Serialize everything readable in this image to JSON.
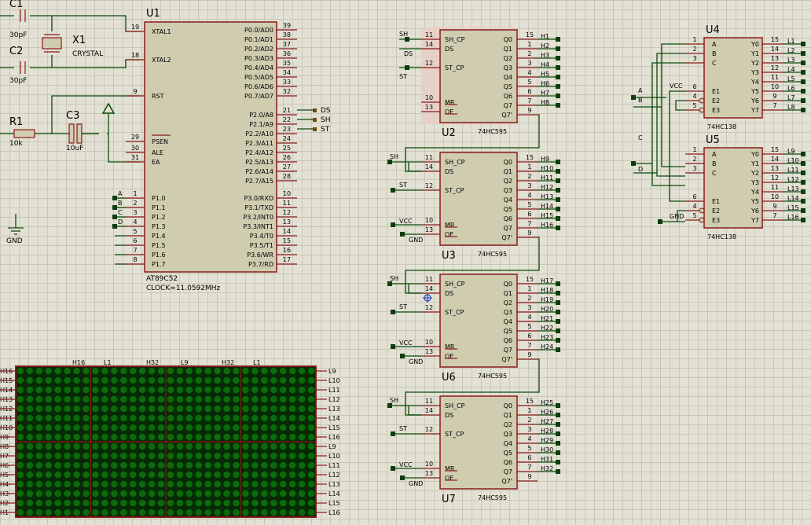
{
  "u1": {
    "ref": "U1",
    "part": "AT89C52",
    "clock": "CLOCK=11.0592MHz",
    "left_pins": [
      {
        "num": "19",
        "name": "XTAL1"
      },
      {
        "num": "18",
        "name": "XTAL2"
      },
      {
        "num": "9",
        "name": "RST"
      },
      {
        "num": "29",
        "name": "PSEN"
      },
      {
        "num": "30",
        "name": "ALE"
      },
      {
        "num": "31",
        "name": "EA"
      },
      {
        "num": "1",
        "name": "P1.0"
      },
      {
        "num": "2",
        "name": "P1.1"
      },
      {
        "num": "3",
        "name": "P1.2"
      },
      {
        "num": "4",
        "name": "P1.3"
      },
      {
        "num": "5",
        "name": "P1.4"
      },
      {
        "num": "6",
        "name": "P1.5"
      },
      {
        "num": "7",
        "name": "P1.6"
      },
      {
        "num": "8",
        "name": "P1.7"
      }
    ],
    "right_pins": [
      {
        "num": "39",
        "name": "P0.0/AD0"
      },
      {
        "num": "38",
        "name": "P0.1/AD1"
      },
      {
        "num": "37",
        "name": "P0.2/AD2"
      },
      {
        "num": "36",
        "name": "P0.3/AD3"
      },
      {
        "num": "35",
        "name": "P0.4/AD4"
      },
      {
        "num": "34",
        "name": "P0.5/AD5"
      },
      {
        "num": "33",
        "name": "P0.6/AD6"
      },
      {
        "num": "32",
        "name": "P0.7/AD7"
      },
      {
        "num": "21",
        "name": "P2.0/A8"
      },
      {
        "num": "22",
        "name": "P2.1/A9"
      },
      {
        "num": "23",
        "name": "P2.2/A10"
      },
      {
        "num": "24",
        "name": "P2.3/A11"
      },
      {
        "num": "25",
        "name": "P2.4/A12"
      },
      {
        "num": "26",
        "name": "P2.5/A13"
      },
      {
        "num": "27",
        "name": "P2.6/A14"
      },
      {
        "num": "28",
        "name": "P2.7/A15"
      },
      {
        "num": "10",
        "name": "P3.0/RXD"
      },
      {
        "num": "11",
        "name": "P3.1/TXD"
      },
      {
        "num": "12",
        "name": "P3.2/INT0"
      },
      {
        "num": "13",
        "name": "P3.3/INT1"
      },
      {
        "num": "14",
        "name": "P3.4/T0"
      },
      {
        "num": "15",
        "name": "P3.5/T1"
      },
      {
        "num": "16",
        "name": "P3.6/WR"
      },
      {
        "num": "17",
        "name": "P3.7/RD"
      }
    ],
    "port2_labels": [
      "DS",
      "SH",
      "ST"
    ],
    "port1_labels": [
      "A",
      "B",
      "C",
      "D"
    ]
  },
  "passives": {
    "c1": {
      "ref": "C1",
      "value": "30pF"
    },
    "c2": {
      "ref": "C2",
      "value": "30pF"
    },
    "x1": {
      "ref": "X1",
      "value": "CRYSTAL"
    },
    "r1": {
      "ref": "R1",
      "value": "10k"
    },
    "c3": {
      "ref": "C3",
      "value": "10uF"
    },
    "gnd": "GND"
  },
  "shift_regs": {
    "part": "74HC595",
    "pin_names_left": [
      "SH_CP",
      "DS",
      "ST_CP",
      "MR",
      "OE"
    ],
    "pin_nums_left": [
      "11",
      "14",
      "12",
      "10",
      "13"
    ],
    "pin_names_right": [
      "Q0",
      "Q1",
      "Q2",
      "Q3",
      "Q4",
      "Q5",
      "Q6",
      "Q7",
      "Q7'"
    ],
    "pin_nums_right": [
      "15",
      "1",
      "2",
      "3",
      "4",
      "5",
      "6",
      "7",
      "9"
    ],
    "net_sh": "SH",
    "net_ds": "DS",
    "net_st": "ST",
    "net_vcc": "VCC",
    "net_gnd": "GND",
    "units": [
      {
        "ref": "U2",
        "outs": [
          "H1",
          "H2",
          "H3",
          "H4",
          "H5",
          "H6",
          "H7",
          "H8"
        ]
      },
      {
        "ref": "U3",
        "outs": [
          "H9",
          "H10",
          "H11",
          "H12",
          "H13",
          "H14",
          "H15",
          "H16"
        ]
      },
      {
        "ref": "U6",
        "outs": [
          "H17",
          "H18",
          "H19",
          "H20",
          "H21",
          "H22",
          "H23",
          "H24"
        ]
      },
      {
        "ref": "U7",
        "outs": [
          "H25",
          "H26",
          "H27",
          "H28",
          "H29",
          "H30",
          "H31",
          "H32"
        ]
      }
    ]
  },
  "decoders": {
    "part": "74HC138",
    "pin_names_left": [
      "A",
      "B",
      "C",
      "E1",
      "E2",
      "E3"
    ],
    "pin_nums_left": [
      "1",
      "2",
      "3",
      "6",
      "4",
      "5"
    ],
    "pin_names_right": [
      "Y0",
      "Y1",
      "Y2",
      "Y3",
      "Y4",
      "Y5",
      "Y6",
      "Y7"
    ],
    "pin_nums_right": [
      "15",
      "14",
      "13",
      "12",
      "11",
      "10",
      "9",
      "7"
    ],
    "net_a": "A",
    "net_b": "B",
    "net_c": "C",
    "net_d": "D",
    "net_vcc": "VCC",
    "net_gnd": "GND",
    "units": [
      {
        "ref": "U4",
        "outs": [
          "L1",
          "L2",
          "L3",
          "L4",
          "L5",
          "L6",
          "L7",
          "L8"
        ]
      },
      {
        "ref": "U5",
        "outs": [
          "L9",
          "L10",
          "L11",
          "L12",
          "L13",
          "L14",
          "L15",
          "L16"
        ]
      }
    ]
  },
  "matrix": {
    "left_labels": [
      "H16",
      "H15",
      "H14",
      "H13",
      "H12",
      "H11",
      "H10",
      "H9",
      "H8",
      "H7",
      "H6",
      "H5",
      "H4",
      "H3",
      "H2",
      "H1"
    ],
    "right_labels": [
      "L9",
      "L10",
      "L11",
      "L12",
      "L13",
      "L14",
      "L15",
      "L16",
      "L9",
      "L10",
      "L11",
      "L12",
      "L13",
      "L14",
      "L15",
      "L16"
    ],
    "top_labels": [
      "H16",
      "L1",
      "H32",
      "L9",
      "H32",
      "L1"
    ],
    "led_color": "#0b6b0b",
    "frame_color": "#8b1a1a"
  }
}
